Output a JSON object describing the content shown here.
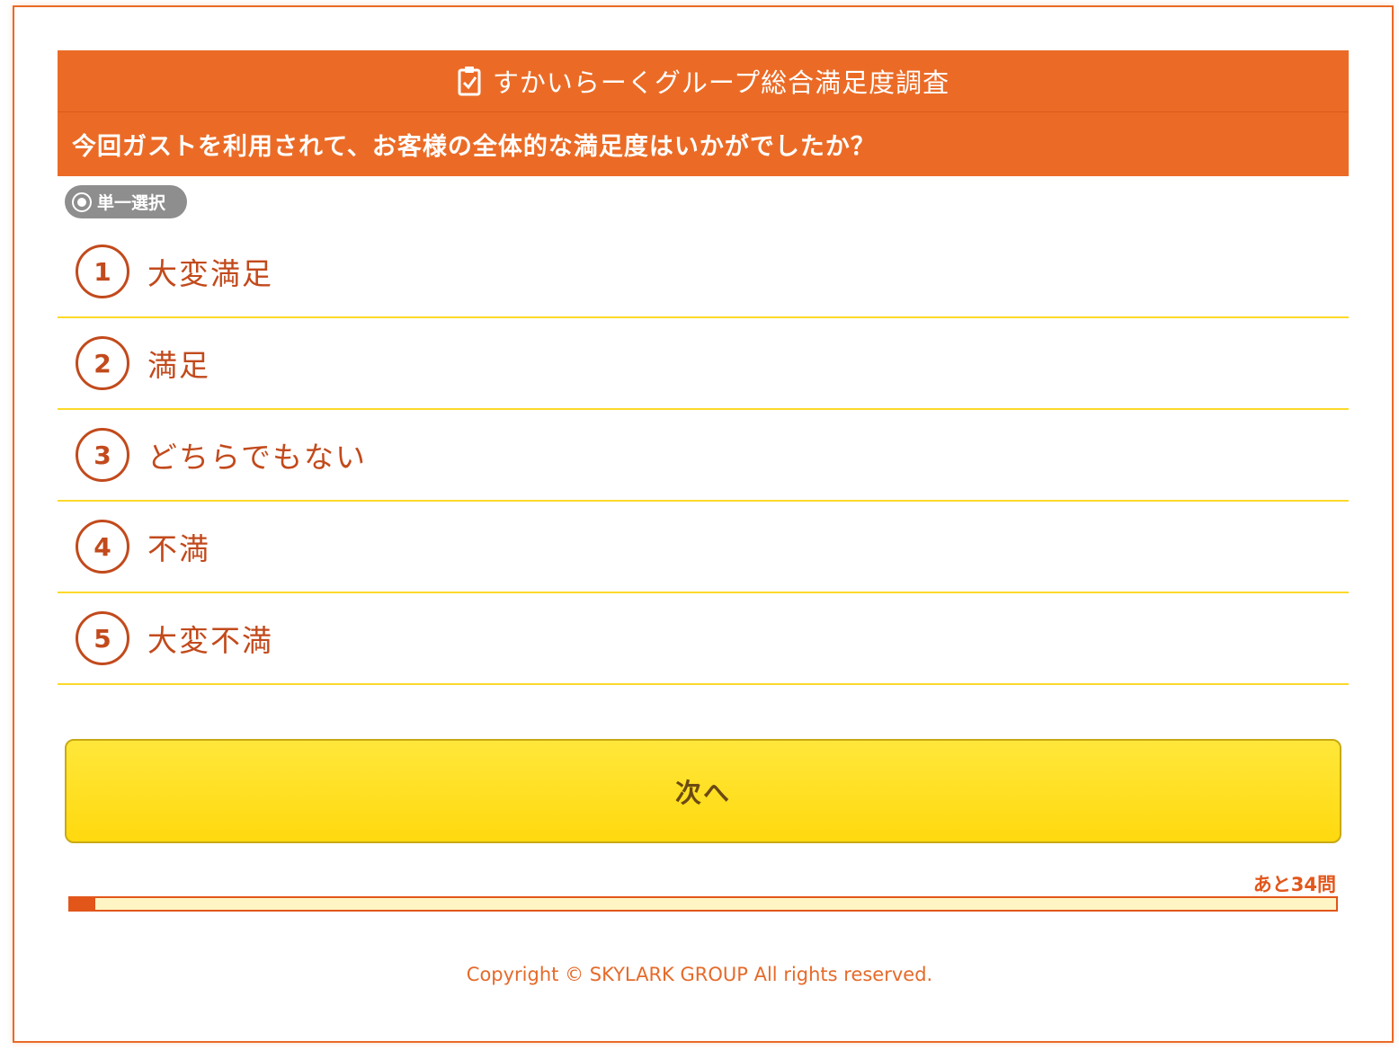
{
  "survey": {
    "title": "すかいらーくグループ総合満足度調査",
    "question": "今回ガストを利用されて、お客様の全体的な満足度はいかがでしたか？",
    "selection_type": "単一選択",
    "options": [
      {
        "number": "1",
        "label": "大変満足"
      },
      {
        "number": "2",
        "label": "満足"
      },
      {
        "number": "3",
        "label": "どちらでもない"
      },
      {
        "number": "4",
        "label": "不満"
      },
      {
        "number": "5",
        "label": "大変不満"
      }
    ],
    "next_label": "次へ",
    "remaining_label": "あと34問",
    "progress_percent": 2
  },
  "footer": {
    "copyright": "Copyright © SKYLARK GROUP All rights reserved."
  },
  "icons": {
    "header_icon": "clipboard-check-icon",
    "badge_icon": "radio-icon"
  },
  "colors": {
    "accent": "#eb6b26",
    "option_text": "#c24a1c",
    "divider": "#fcd92a",
    "button": "#ffd90f",
    "badge": "#8e8e8e"
  }
}
